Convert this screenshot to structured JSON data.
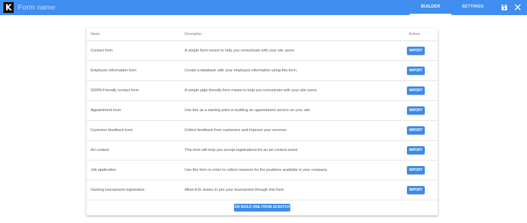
{
  "header": {
    "logo_letter": "K",
    "form_name_placeholder": "Form name",
    "tabs": [
      {
        "label": "BUILDER",
        "active": true
      },
      {
        "label": "SETTINGS",
        "active": false
      }
    ],
    "save_icon": "floppy-disk-icon",
    "close_icon": "close-icon",
    "bar_color": "#3f8ef0"
  },
  "table": {
    "columns": [
      "Name",
      "Description",
      "Actions"
    ],
    "rows": [
      {
        "name": "Contact form",
        "description": "A simple form meant to help you comunicate with your site users.",
        "action": "IMPORT"
      },
      {
        "name": "Employee information form",
        "description": "Create a database with your employee information using this form.",
        "action": "IMPORT"
      },
      {
        "name": "GDPR-Friendly contact form",
        "description": "A simple gdpr-friendly form meant to help you comunicate with your site users.",
        "action": "IMPORT"
      },
      {
        "name": "Appointment form",
        "description": "Use this as a starting point in building an appointment service on your site.",
        "action": "IMPORT"
      },
      {
        "name": "Customer feedback form",
        "description": "Collect feedback from customers and improve your services.",
        "action": "IMPORT"
      },
      {
        "name": "Art contest",
        "description": "This form will help you accept registrations for an art contest event.",
        "action": "IMPORT"
      },
      {
        "name": "Job application",
        "description": "Use this form in order to collect resumes for the positions available in your company.",
        "action": "IMPORT"
      },
      {
        "name": "Gaming tournament registration",
        "description": "Allow ESL teams to join your tournament through this form.",
        "action": "IMPORT"
      }
    ]
  },
  "footer": {
    "scratch_button_label": "OR BUILD ONE FROM SCRATCH"
  },
  "accent_color": "#3c8ae8"
}
